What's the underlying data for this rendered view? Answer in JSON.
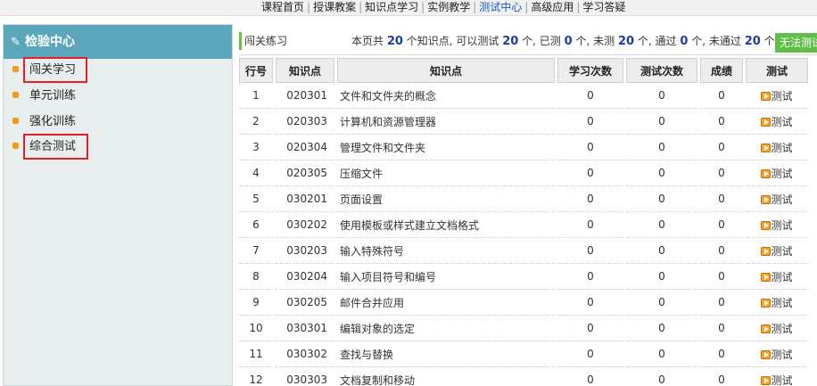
{
  "topnav": {
    "items": [
      "课程首页",
      "授课教案",
      "知识点学习",
      "实例教学",
      "测试中心",
      "高级应用",
      "学习答疑"
    ],
    "active_index": 4,
    "separator": "|"
  },
  "sidebar": {
    "title": "检验中心",
    "icon": "pencil-icon",
    "items": [
      {
        "label": "闯关学习",
        "highlighted": true
      },
      {
        "label": "单元训练",
        "highlighted": false
      },
      {
        "label": "强化训练",
        "highlighted": false
      },
      {
        "label": "综合测试",
        "highlighted": true
      }
    ]
  },
  "info_bar": {
    "title": "闯关练习",
    "stats_prefix": "本页共",
    "total": "20",
    "text_knowledge": "个知识点, 可以测试",
    "testable": "20",
    "text_done": "个, 已测",
    "tested": "0",
    "text_untested": "个, 未测",
    "untested": "20",
    "text_passed": "个, 通过",
    "passed": "0",
    "text_failed": "个, 未通过",
    "failed": "20",
    "text_end": "个",
    "button_label": "无法测试"
  },
  "table": {
    "headers": [
      "行号",
      "知识点",
      "知识点",
      "学习次数",
      "测试次数",
      "成绩",
      "测试"
    ],
    "rows": [
      {
        "no": "1",
        "id": "020301",
        "name": "文件和文件夹的概念",
        "study": "0",
        "tests": "0",
        "score": "0",
        "action": "测试"
      },
      {
        "no": "2",
        "id": "020303",
        "name": "计算机和资源管理器",
        "study": "0",
        "tests": "0",
        "score": "0",
        "action": "测试"
      },
      {
        "no": "3",
        "id": "020304",
        "name": "管理文件和文件夹",
        "study": "0",
        "tests": "0",
        "score": "0",
        "action": "测试"
      },
      {
        "no": "4",
        "id": "020305",
        "name": "压缩文件",
        "study": "0",
        "tests": "0",
        "score": "0",
        "action": "测试"
      },
      {
        "no": "5",
        "id": "030201",
        "name": "页面设置",
        "study": "0",
        "tests": "0",
        "score": "0",
        "action": "测试"
      },
      {
        "no": "6",
        "id": "030202",
        "name": "使用模板或样式建立文档格式",
        "study": "0",
        "tests": "0",
        "score": "0",
        "action": "测试"
      },
      {
        "no": "7",
        "id": "030203",
        "name": "输入特殊符号",
        "study": "0",
        "tests": "0",
        "score": "0",
        "action": "测试"
      },
      {
        "no": "8",
        "id": "030204",
        "name": "输入项目符号和编号",
        "study": "0",
        "tests": "0",
        "score": "0",
        "action": "测试"
      },
      {
        "no": "9",
        "id": "030205",
        "name": "邮件合并应用",
        "study": "0",
        "tests": "0",
        "score": "0",
        "action": "测试"
      },
      {
        "no": "10",
        "id": "030301",
        "name": "编辑对象的选定",
        "study": "0",
        "tests": "0",
        "score": "0",
        "action": "测试"
      },
      {
        "no": "11",
        "id": "030302",
        "name": "查找与替换",
        "study": "0",
        "tests": "0",
        "score": "0",
        "action": "测试"
      },
      {
        "no": "12",
        "id": "030303",
        "name": "文档复制和移动",
        "study": "0",
        "tests": "0",
        "score": "0",
        "action": "测试"
      }
    ]
  },
  "colors": {
    "sidebar_header": "#5ba6bb",
    "sidebar_bg": "#e8eeee",
    "highlight_box": "#e0202a",
    "bullet": "#f39a18",
    "button": "#5fbf48",
    "stat_number": "#1a3cb0",
    "active_nav": "#1a55c8"
  }
}
